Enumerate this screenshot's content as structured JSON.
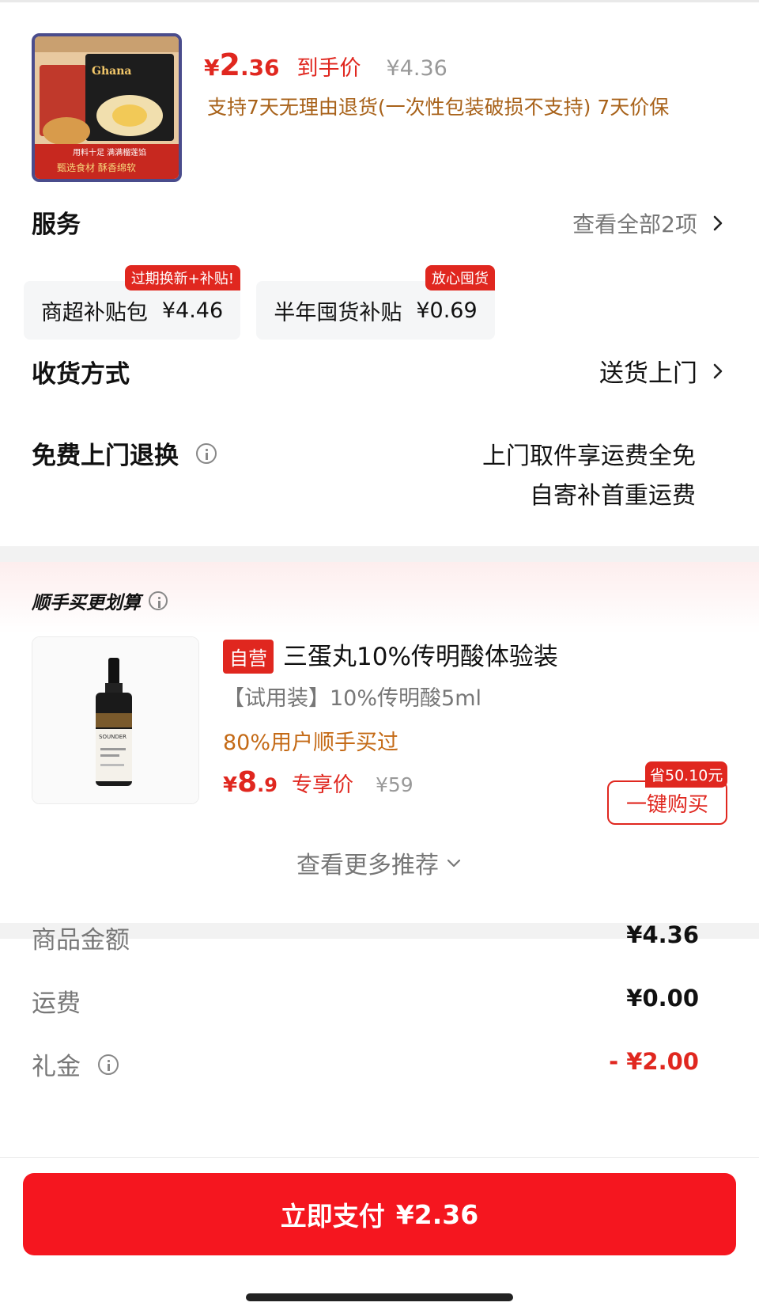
{
  "product": {
    "price_currency": "¥",
    "price_int": "2",
    "price_dec": ".36",
    "price_tag": "到手价",
    "orig_price": "¥4.36",
    "policy": "支持7天无理由退货(一次性包装破损不支持) 7天价保",
    "thumb_texts": [
      "Ghana",
      "用料十足 满满榴莲馅",
      "甄选食材 酥香绵软"
    ]
  },
  "service": {
    "title": "服务",
    "view_all": "查看全部2项",
    "chips": [
      {
        "label": "商超补贴包",
        "price": "¥4.46",
        "badge": "过期换新+补贴!"
      },
      {
        "label": "半年囤货补贴",
        "price": "¥0.69",
        "badge": "放心囤货"
      }
    ]
  },
  "delivery": {
    "title": "收货方式",
    "value": "送货上门"
  },
  "returns": {
    "title": "免费上门退换",
    "line1": "上门取件享运费全免",
    "line2": "自寄补首重运费"
  },
  "recommend": {
    "title": "顺手买更划算",
    "title_plus": "+",
    "item": {
      "self_tag": "自营",
      "name": "三蛋丸10%传明酸体验装",
      "subtitle": "【试用装】10%传明酸5ml",
      "buyers": "80%用户顺手买过",
      "price_currency": "¥",
      "price_int": "8",
      "price_dec": ".9",
      "price_tag": "专享价",
      "orig_price": "¥59",
      "save_badge": "省50.10元",
      "buy_label": "一键购买",
      "bottle_text": "SOUNDER"
    },
    "more": "查看更多推荐"
  },
  "costs": {
    "rows": [
      {
        "label": "商品金额",
        "value": "¥4.36"
      },
      {
        "label": "运费",
        "value": "¥0.00"
      },
      {
        "label": "礼金",
        "value": "- ¥2.00"
      }
    ]
  },
  "pay": {
    "label": "立即支付",
    "amount": "¥2.36"
  },
  "colors": {
    "accent": "#e0271f",
    "pay_button": "#f5161f",
    "policy_brown": "#a8621a",
    "buyers_orange": "#c46a16"
  }
}
